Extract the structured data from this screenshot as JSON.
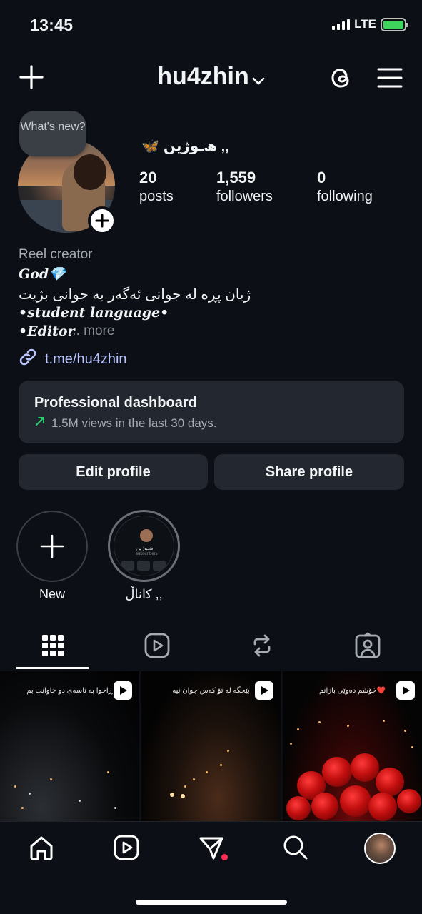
{
  "status_bar": {
    "time": "13:45",
    "network": "LTE"
  },
  "header": {
    "username": "hu4zhin"
  },
  "profile": {
    "bubble_text": "What's new?",
    "display_name": "ﮪـوژین ,,",
    "stats": [
      {
        "value": "20",
        "label": "posts"
      },
      {
        "value": "1,559",
        "label": "followers"
      },
      {
        "value": "0",
        "label": "following"
      }
    ]
  },
  "bio": {
    "category": "Reel creator",
    "line1": "God💎",
    "line2": "ژیان پڕە لە جوانی ئەگەر بە جوانی بژیت",
    "line3": "•student language•",
    "line4": "•Editor",
    "more": "... more",
    "link": "t.me/hu4zhin"
  },
  "dashboard": {
    "title": "Professional dashboard",
    "subtitle": "1.5M views in the last 30 days."
  },
  "buttons": {
    "edit": "Edit profile",
    "share": "Share profile"
  },
  "highlights": [
    {
      "label": "New"
    },
    {
      "label": "ﮐاناڵ ,,",
      "preview_name": "ﮪـوژین",
      "preview_sub": "subscribers"
    }
  ],
  "posts": [
    {
      "caption": "ڕاخوا بە ناسەی دو چاوانت بم"
    },
    {
      "caption": "بێجگە لە تۆ کەس جوان نیە"
    },
    {
      "caption": "خۆشم دەوێی بازانم❤️"
    }
  ],
  "colors": {
    "background": "#0c1016",
    "card": "#23272f",
    "link": "#b9c4ff",
    "accent_green": "#2ecc71",
    "notification": "#ff2d55"
  },
  "icons": {
    "top_left": "plus-icon",
    "top_right": [
      "threads-icon",
      "menu-icon"
    ],
    "tabs": [
      "grid-icon",
      "reels-icon",
      "reposts-icon",
      "tagged-icon"
    ],
    "nav": [
      "home-icon",
      "reels-icon",
      "send-icon",
      "search-icon",
      "profile-avatar"
    ]
  }
}
